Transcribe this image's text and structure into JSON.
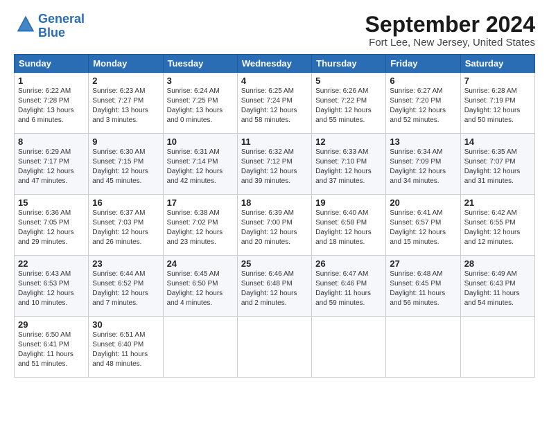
{
  "logo": {
    "line1": "General",
    "line2": "Blue"
  },
  "title": "September 2024",
  "location": "Fort Lee, New Jersey, United States",
  "weekdays": [
    "Sunday",
    "Monday",
    "Tuesday",
    "Wednesday",
    "Thursday",
    "Friday",
    "Saturday"
  ],
  "weeks": [
    [
      {
        "day": "1",
        "sunrise": "6:22 AM",
        "sunset": "7:28 PM",
        "daylight": "13 hours and 6 minutes."
      },
      {
        "day": "2",
        "sunrise": "6:23 AM",
        "sunset": "7:27 PM",
        "daylight": "13 hours and 3 minutes."
      },
      {
        "day": "3",
        "sunrise": "6:24 AM",
        "sunset": "7:25 PM",
        "daylight": "13 hours and 0 minutes."
      },
      {
        "day": "4",
        "sunrise": "6:25 AM",
        "sunset": "7:24 PM",
        "daylight": "12 hours and 58 minutes."
      },
      {
        "day": "5",
        "sunrise": "6:26 AM",
        "sunset": "7:22 PM",
        "daylight": "12 hours and 55 minutes."
      },
      {
        "day": "6",
        "sunrise": "6:27 AM",
        "sunset": "7:20 PM",
        "daylight": "12 hours and 52 minutes."
      },
      {
        "day": "7",
        "sunrise": "6:28 AM",
        "sunset": "7:19 PM",
        "daylight": "12 hours and 50 minutes."
      }
    ],
    [
      {
        "day": "8",
        "sunrise": "6:29 AM",
        "sunset": "7:17 PM",
        "daylight": "12 hours and 47 minutes."
      },
      {
        "day": "9",
        "sunrise": "6:30 AM",
        "sunset": "7:15 PM",
        "daylight": "12 hours and 45 minutes."
      },
      {
        "day": "10",
        "sunrise": "6:31 AM",
        "sunset": "7:14 PM",
        "daylight": "12 hours and 42 minutes."
      },
      {
        "day": "11",
        "sunrise": "6:32 AM",
        "sunset": "7:12 PM",
        "daylight": "12 hours and 39 minutes."
      },
      {
        "day": "12",
        "sunrise": "6:33 AM",
        "sunset": "7:10 PM",
        "daylight": "12 hours and 37 minutes."
      },
      {
        "day": "13",
        "sunrise": "6:34 AM",
        "sunset": "7:09 PM",
        "daylight": "12 hours and 34 minutes."
      },
      {
        "day": "14",
        "sunrise": "6:35 AM",
        "sunset": "7:07 PM",
        "daylight": "12 hours and 31 minutes."
      }
    ],
    [
      {
        "day": "15",
        "sunrise": "6:36 AM",
        "sunset": "7:05 PM",
        "daylight": "12 hours and 29 minutes."
      },
      {
        "day": "16",
        "sunrise": "6:37 AM",
        "sunset": "7:03 PM",
        "daylight": "12 hours and 26 minutes."
      },
      {
        "day": "17",
        "sunrise": "6:38 AM",
        "sunset": "7:02 PM",
        "daylight": "12 hours and 23 minutes."
      },
      {
        "day": "18",
        "sunrise": "6:39 AM",
        "sunset": "7:00 PM",
        "daylight": "12 hours and 20 minutes."
      },
      {
        "day": "19",
        "sunrise": "6:40 AM",
        "sunset": "6:58 PM",
        "daylight": "12 hours and 18 minutes."
      },
      {
        "day": "20",
        "sunrise": "6:41 AM",
        "sunset": "6:57 PM",
        "daylight": "12 hours and 15 minutes."
      },
      {
        "day": "21",
        "sunrise": "6:42 AM",
        "sunset": "6:55 PM",
        "daylight": "12 hours and 12 minutes."
      }
    ],
    [
      {
        "day": "22",
        "sunrise": "6:43 AM",
        "sunset": "6:53 PM",
        "daylight": "12 hours and 10 minutes."
      },
      {
        "day": "23",
        "sunrise": "6:44 AM",
        "sunset": "6:52 PM",
        "daylight": "12 hours and 7 minutes."
      },
      {
        "day": "24",
        "sunrise": "6:45 AM",
        "sunset": "6:50 PM",
        "daylight": "12 hours and 4 minutes."
      },
      {
        "day": "25",
        "sunrise": "6:46 AM",
        "sunset": "6:48 PM",
        "daylight": "12 hours and 2 minutes."
      },
      {
        "day": "26",
        "sunrise": "6:47 AM",
        "sunset": "6:46 PM",
        "daylight": "11 hours and 59 minutes."
      },
      {
        "day": "27",
        "sunrise": "6:48 AM",
        "sunset": "6:45 PM",
        "daylight": "11 hours and 56 minutes."
      },
      {
        "day": "28",
        "sunrise": "6:49 AM",
        "sunset": "6:43 PM",
        "daylight": "11 hours and 54 minutes."
      }
    ],
    [
      {
        "day": "29",
        "sunrise": "6:50 AM",
        "sunset": "6:41 PM",
        "daylight": "11 hours and 51 minutes."
      },
      {
        "day": "30",
        "sunrise": "6:51 AM",
        "sunset": "6:40 PM",
        "daylight": "11 hours and 48 minutes."
      },
      null,
      null,
      null,
      null,
      null
    ]
  ]
}
